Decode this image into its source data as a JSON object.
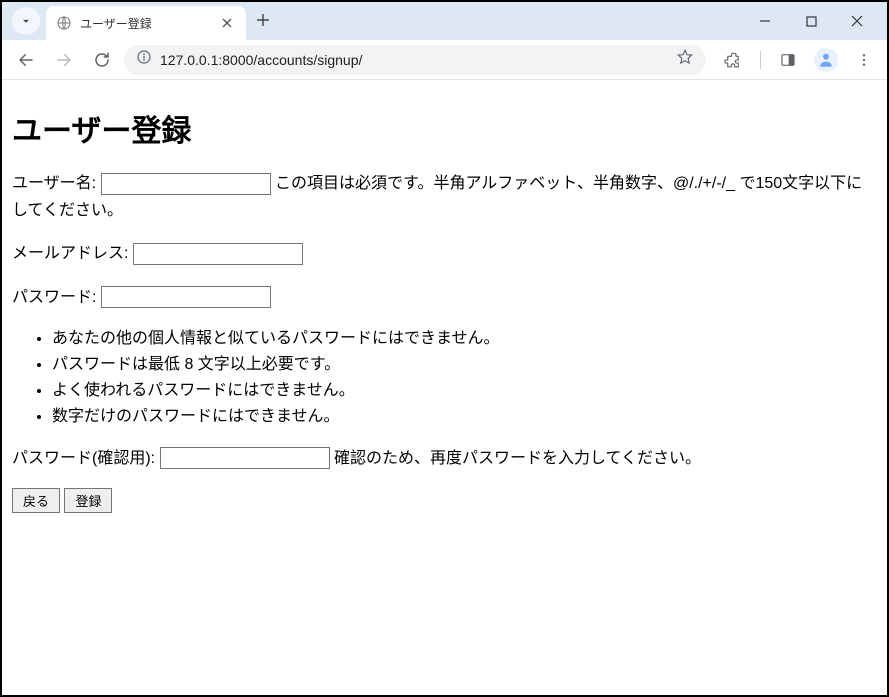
{
  "browser": {
    "tab_title": "ユーザー登録",
    "url": "127.0.0.1:8000/accounts/signup/"
  },
  "page": {
    "heading": "ユーザー登録",
    "username": {
      "label": "ユーザー名:",
      "help": "この項目は必須です。半角アルファベット、半角数字、@/./+/-/_ で150文字以下にしてください。"
    },
    "email": {
      "label": "メールアドレス:"
    },
    "password": {
      "label": "パスワード:",
      "hints": [
        "あなたの他の個人情報と似ているパスワードにはできません。",
        "パスワードは最低 8 文字以上必要です。",
        "よく使われるパスワードにはできません。",
        "数字だけのパスワードにはできません。"
      ]
    },
    "password_confirm": {
      "label": "パスワード(確認用):",
      "help": "確認のため、再度パスワードを入力してください。"
    },
    "buttons": {
      "back": "戻る",
      "submit": "登録"
    }
  }
}
